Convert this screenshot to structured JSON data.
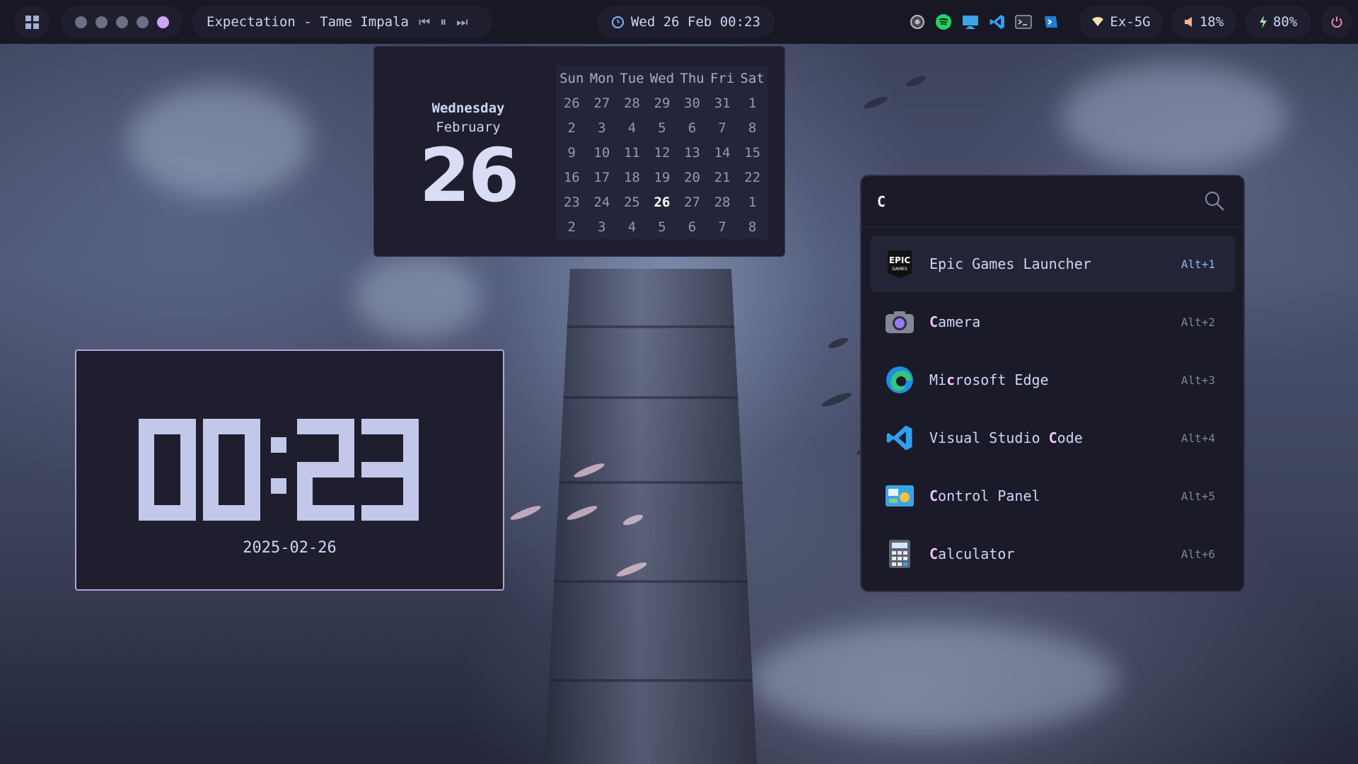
{
  "topbar": {
    "media": {
      "track": "Expectation - Tame Impala",
      "prev": "⏮",
      "pause": "⏸",
      "next": "⏭"
    },
    "clock": "Wed 26 Feb 00:23",
    "wifi": {
      "icon": "wifi-icon",
      "label": "Ex-5G"
    },
    "volume": {
      "icon": "speaker-icon",
      "label": "18%"
    },
    "battery": {
      "icon": "charging-bolt-icon",
      "label": "80%"
    },
    "tray_icons": [
      "obs-icon",
      "spotify-icon",
      "monitor-icon",
      "vscode-icon",
      "terminal-icon",
      "powershell-icon"
    ],
    "workspaces": 5,
    "active_workspace": 5,
    "accent": "#cba6f7"
  },
  "calendar": {
    "weekday": "Wednesday",
    "month": "February",
    "day": "26",
    "headers": [
      "Sun",
      "Mon",
      "Tue",
      "Wed",
      "Thu",
      "Fri",
      "Sat"
    ],
    "weeks": [
      [
        "26",
        "27",
        "28",
        "29",
        "30",
        "31",
        "1"
      ],
      [
        "2",
        "3",
        "4",
        "5",
        "6",
        "7",
        "8"
      ],
      [
        "9",
        "10",
        "11",
        "12",
        "13",
        "14",
        "15"
      ],
      [
        "16",
        "17",
        "18",
        "19",
        "20",
        "21",
        "22"
      ],
      [
        "23",
        "24",
        "25",
        "26",
        "27",
        "28",
        "1"
      ],
      [
        "2",
        "3",
        "4",
        "5",
        "6",
        "7",
        "8"
      ]
    ],
    "today": "26"
  },
  "clock_widget": {
    "time": "00:23",
    "date": "2025-02-26"
  },
  "launcher": {
    "query": "C",
    "items": [
      {
        "name": "Epic Games Launcher",
        "hl": "",
        "shortcut": "Alt+1",
        "icon": "epic-games-icon"
      },
      {
        "name": "Camera",
        "hl": "C",
        "shortcut": "Alt+2",
        "icon": "camera-icon"
      },
      {
        "name": "Microsoft Edge",
        "hl": "c",
        "shortcut": "Alt+3",
        "icon": "edge-icon"
      },
      {
        "name": "Visual Studio Code",
        "hl": "C",
        "shortcut": "Alt+4",
        "icon": "vscode-icon"
      },
      {
        "name": "Control Panel",
        "hl": "C",
        "shortcut": "Alt+5",
        "icon": "control-panel-icon"
      },
      {
        "name": "Calculator",
        "hl": "C",
        "shortcut": "Alt+6",
        "icon": "calculator-icon"
      }
    ],
    "selected_index": 0
  }
}
